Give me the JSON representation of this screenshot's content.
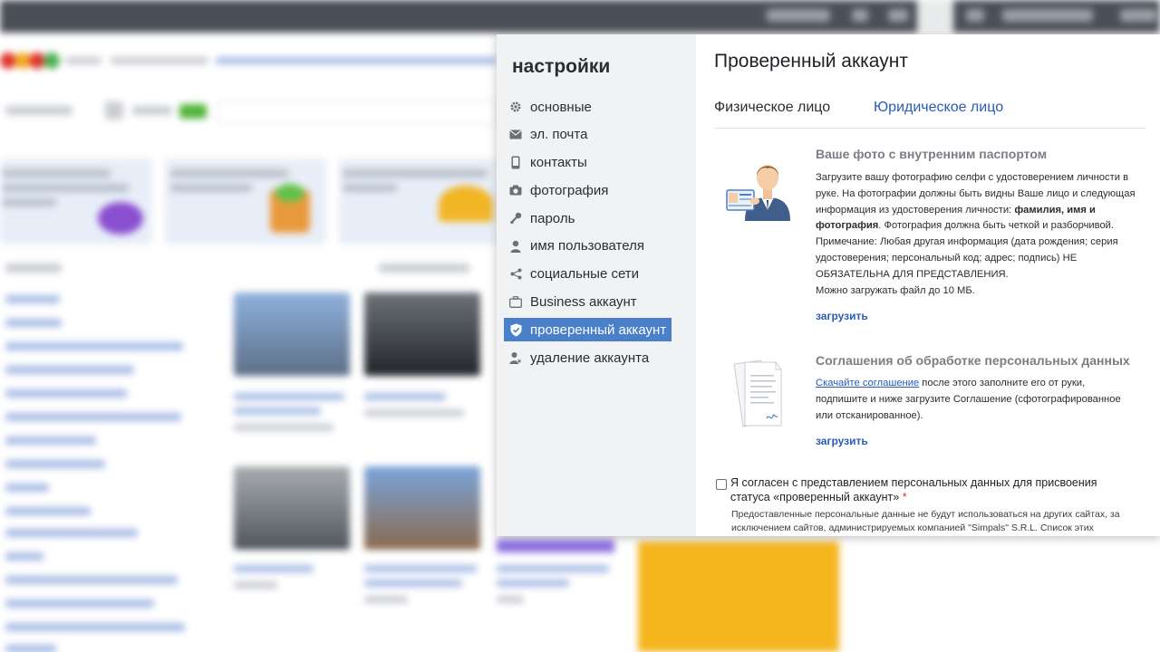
{
  "colors": {
    "accent": "#4a7fc9",
    "link": "#2a5bb5",
    "sidebar_bg": "#f1f2f4",
    "topbar_bg": "#4a4f57"
  },
  "sidebar": {
    "title": "настройки",
    "items": [
      {
        "label": "основные",
        "icon": "gear-icon"
      },
      {
        "label": "эл. почта",
        "icon": "envelope-icon"
      },
      {
        "label": "контакты",
        "icon": "phone-icon"
      },
      {
        "label": "фотография",
        "icon": "camera-icon"
      },
      {
        "label": "пароль",
        "icon": "key-icon"
      },
      {
        "label": "имя пользователя",
        "icon": "user-icon"
      },
      {
        "label": "социальные сети",
        "icon": "share-icon"
      },
      {
        "label": "Business аккаунт",
        "icon": "briefcase-icon"
      },
      {
        "label": "проверенный аккаунт",
        "icon": "shield-check-icon",
        "active": true
      },
      {
        "label": "удаление аккаунта",
        "icon": "user-remove-icon"
      }
    ]
  },
  "main": {
    "title": "Проверенный аккаунт",
    "tabs": [
      {
        "label": "Физическое лицо"
      },
      {
        "label": "Юридическое лицо"
      }
    ],
    "passport_section": {
      "title": "Ваше фото с внутренним паспортом",
      "text_1": "Загрузите вашу фотографию селфи с удостоверением личности в руке. На фотографии должны быть видны Ваше лицо и следующая информация из удостоверения личности: ",
      "text_bold": "фамилия, имя и фотография",
      "text_2": ". Фотография должна быть четкой и разборчивой.",
      "text_3": "Примечание: Любая другая информация (дата рождения; серия удостоверения; персональный код; адрес; подпись) НЕ ОБЯЗАТЕЛЬНА ДЛЯ ПРЕДСТАВЛЕНИЯ.",
      "text_4": "Можно загружать файл до 10 МБ.",
      "upload_label": "загрузить"
    },
    "agreement_section": {
      "title": "Соглашения об обработке персональных данных",
      "link_text": "Скачайте соглашение",
      "text": " после этого заполните его от руки, подпишите и ниже загрузите Соглашение (сфотографированное или отсканированное).",
      "upload_label": "загрузить"
    },
    "consent": {
      "label": "Я согласен с представлением персональных данных для присвоения статуса «проверенный аккаунт»",
      "required_mark": "*",
      "note": "Предоставленные персональные данные не будут использоваться на других сайтах, за исключением сайтов, администрируемых компанией \"Simpals\" S.R.L. Список этих сайтов"
    }
  }
}
